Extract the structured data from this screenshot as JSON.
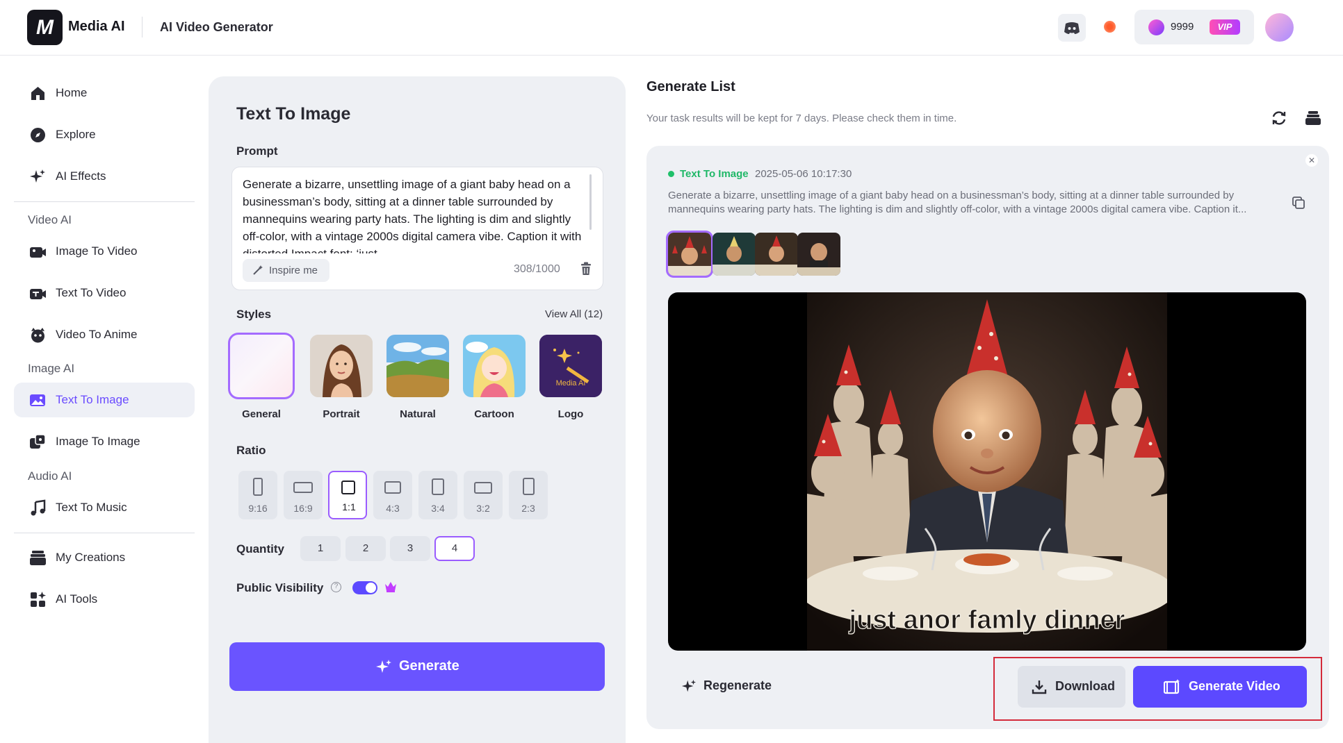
{
  "header": {
    "brand": "Media AI",
    "logo_text": "M",
    "app_title": "AI Video Generator",
    "credits": "9999",
    "vip_label": "VIP"
  },
  "sidebar": {
    "top_items": [
      {
        "label": "Home",
        "icon": "home-icon"
      },
      {
        "label": "Explore",
        "icon": "compass-icon"
      },
      {
        "label": "AI Effects",
        "icon": "sparkles-icon"
      }
    ],
    "video_section": "Video AI",
    "video_items": [
      {
        "label": "Image To Video",
        "icon": "image-video-icon"
      },
      {
        "label": "Text To Video",
        "icon": "text-video-icon"
      },
      {
        "label": "Video To Anime",
        "icon": "anime-icon"
      }
    ],
    "image_section": "Image AI",
    "image_items": [
      {
        "label": "Text To Image",
        "icon": "text-image-icon",
        "active": true
      },
      {
        "label": "Image To Image",
        "icon": "image-image-icon"
      }
    ],
    "audio_section": "Audio AI",
    "audio_items": [
      {
        "label": "Text To Music",
        "icon": "music-note-icon"
      }
    ],
    "bottom_items": [
      {
        "label": "My Creations",
        "icon": "creations-icon"
      },
      {
        "label": "AI Tools",
        "icon": "tools-icon"
      }
    ]
  },
  "form": {
    "title": "Text To Image",
    "prompt_label": "Prompt",
    "prompt_value": "Generate a bizarre, unsettling image of a giant baby head on a businessman’s body, sitting at a dinner table surrounded by mannequins wearing party hats. The lighting is dim and slightly off-color, with a vintage 2000s digital camera vibe. Caption it with distorted Impact font: ‘just",
    "inspire_label": "Inspire me",
    "char_count": "308/1000",
    "styles_label": "Styles",
    "view_all": "View All (12)",
    "styles": [
      {
        "name": "General",
        "selected": true
      },
      {
        "name": "Portrait"
      },
      {
        "name": "Natural"
      },
      {
        "name": "Cartoon"
      },
      {
        "name": "Logo",
        "badge": "Media AI"
      }
    ],
    "ratio_label": "Ratio",
    "ratios": [
      "9:16",
      "16:9",
      "1:1",
      "4:3",
      "3:4",
      "3:2",
      "2:3"
    ],
    "ratio_selected": "1:1",
    "quantity_label": "Quantity",
    "quantities": [
      "1",
      "2",
      "3",
      "4"
    ],
    "quantity_selected": "4",
    "visibility_label": "Public Visibility",
    "visibility_on": true,
    "generate_label": "Generate"
  },
  "results": {
    "title": "Generate List",
    "note": "Your task results will be kept for 7 days. Please check them in time.",
    "task": {
      "type": "Text To Image",
      "time": "2025-05-06 10:17:30",
      "prompt": "Generate a bizarre, unsettling image of a giant baby head on a businessman’s body, sitting at a dinner table surrounded by mannequins wearing party hats. The lighting is dim and slightly off-color, with a vintage 2000s digital camera vibe. Caption it...",
      "caption": "just anor famly dinner",
      "thumb_count": 4
    },
    "regenerate_label": "Regenerate",
    "download_label": "Download",
    "generate_video_label": "Generate Video"
  },
  "colors": {
    "accent": "#5c49ff",
    "selected_outline": "#a46bff",
    "success": "#20b868",
    "highlight_box": "#d42a3a"
  }
}
